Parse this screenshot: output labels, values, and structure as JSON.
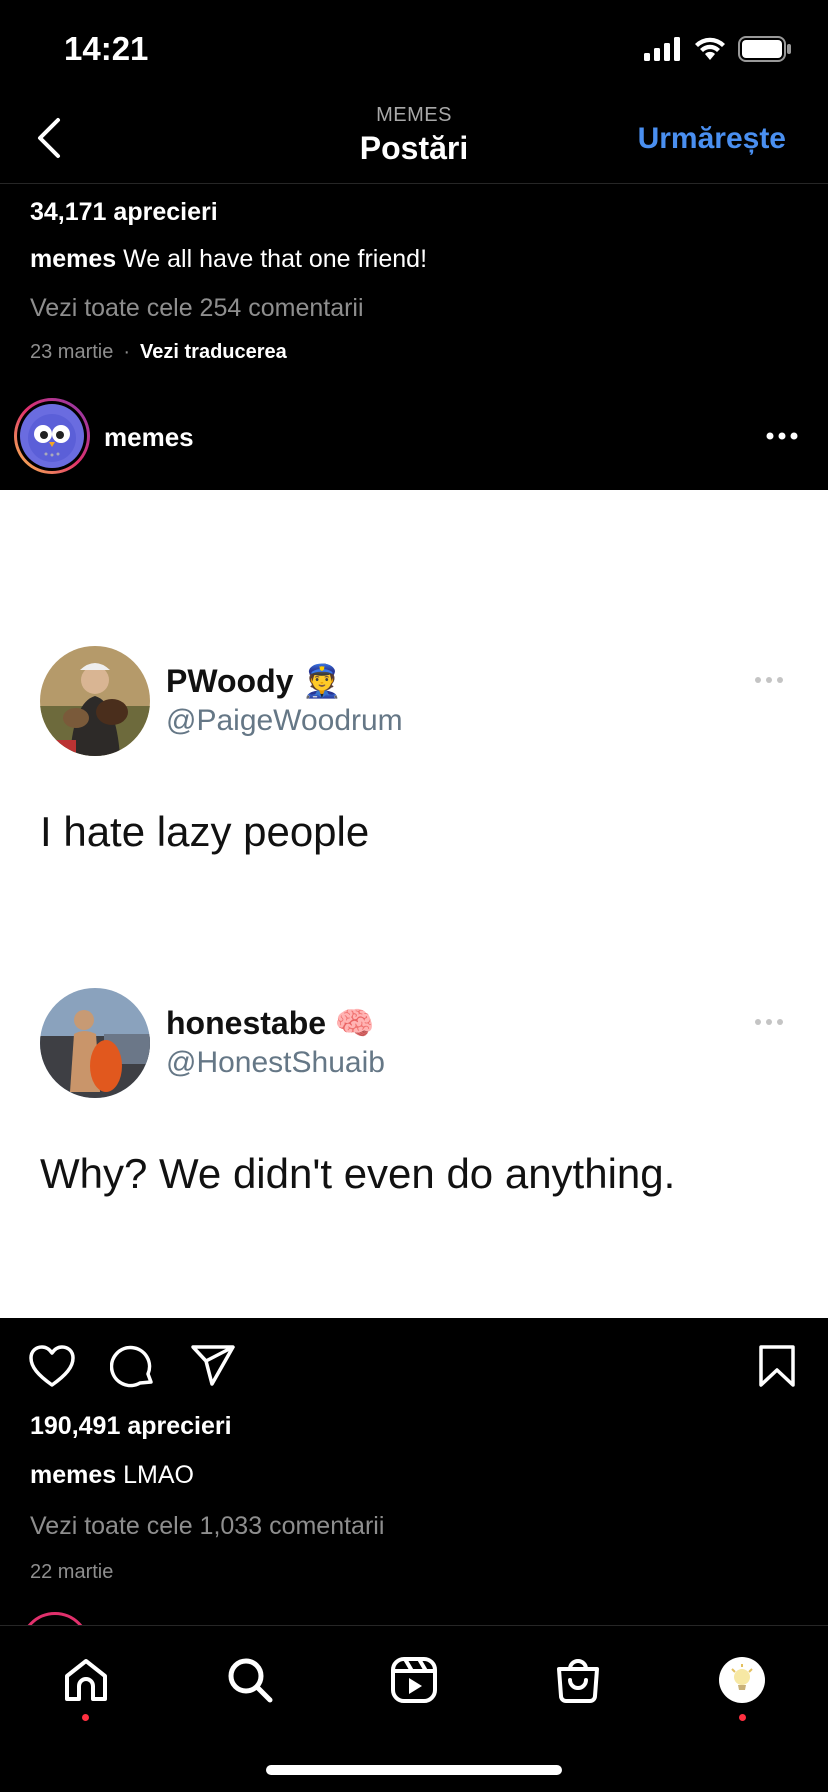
{
  "status_bar": {
    "time": "14:21"
  },
  "header": {
    "subtitle": "MEMES",
    "title": "Postări",
    "follow_label": "Urmărește"
  },
  "previous_post": {
    "likes": "34,171 aprecieri",
    "caption_user": "memes",
    "caption_text": "We all have that one friend!",
    "comments_link": "Vezi toate cele 254 comentarii",
    "date": "23 martie",
    "separator": "·",
    "translate_label": "Vezi traducerea"
  },
  "post": {
    "username": "memes",
    "tweets": [
      {
        "name": "PWoody",
        "emoji": "👮",
        "handle": "@PaigeWoodrum",
        "text": "I hate lazy people"
      },
      {
        "name": "honestabe",
        "emoji": "🧠",
        "handle": "@HonestShuaib",
        "text": "Why? We didn't even do anything."
      }
    ],
    "likes": "190,491 aprecieri",
    "caption_user": "memes",
    "caption_text": "LMAO",
    "comments_link": "Vezi toate cele 1,033 comentarii",
    "date": "22 martie"
  },
  "colors": {
    "accent": "#4a8ff0",
    "notification": "#ff3040",
    "background": "#000000"
  },
  "tabs": [
    "home-icon",
    "search-icon",
    "reels-icon",
    "shop-icon",
    "profile-icon"
  ]
}
